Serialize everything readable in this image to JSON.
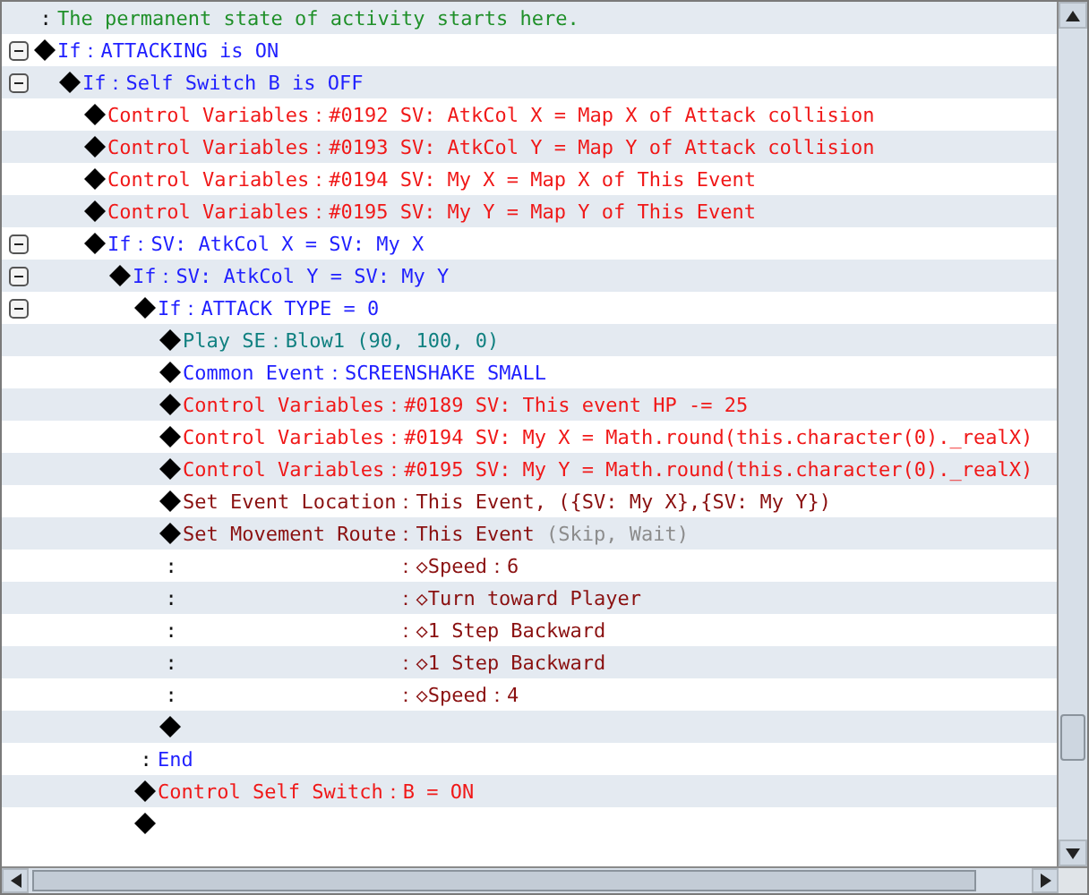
{
  "rows": [
    {
      "kind": "comment",
      "marker": ":",
      "text": "The permanent state of activity starts here."
    },
    {
      "kind": "branch",
      "expanded": true,
      "text": "If：ATTACKING is ON",
      "children": [
        {
          "kind": "branch",
          "expanded": true,
          "text": "If：Self Switch B is OFF",
          "children": [
            {
              "kind": "control",
              "text": "Control Variables：#0192 SV: AtkCol X = Map X of Attack collision"
            },
            {
              "kind": "control",
              "text": "Control Variables：#0193 SV: AtkCol Y = Map Y of Attack collision"
            },
            {
              "kind": "control",
              "text": "Control Variables：#0194 SV: My X = Map X of This Event"
            },
            {
              "kind": "control",
              "text": "Control Variables：#0195 SV: My Y = Map Y of This Event"
            },
            {
              "kind": "branch",
              "expanded": true,
              "text": "If：SV: AtkCol X = SV: My X",
              "children": [
                {
                  "kind": "branch",
                  "expanded": true,
                  "text": "If：SV: AtkCol Y = SV: My Y",
                  "children": [
                    {
                      "kind": "branch",
                      "expanded": true,
                      "text": "If：ATTACK TYPE = 0",
                      "children": [
                        {
                          "kind": "sound",
                          "text": "Play SE：Blow1 (90, 100, 0)"
                        },
                        {
                          "kind": "common",
                          "text": "Common Event：SCREENSHAKE SMALL"
                        },
                        {
                          "kind": "control",
                          "text": "Control Variables：#0189 SV: This event HP -= 25"
                        },
                        {
                          "kind": "control",
                          "text": "Control Variables：#0194 SV: My X = Math.round(this.character(0)._realX)"
                        },
                        {
                          "kind": "control",
                          "text": "Control Variables：#0195 SV: My Y = Math.round(this.character(0)._realX)"
                        },
                        {
                          "kind": "location",
                          "text": "Set Event Location：This Event, ({SV: My X},{SV: My Y})"
                        },
                        {
                          "kind": "route",
                          "text": "Set Movement Route：This Event",
                          "note": "(Skip, Wait)",
                          "steps": [
                            {
                              "marker": ":",
                              "text": "：◇Speed：6"
                            },
                            {
                              "marker": ":",
                              "text": "：◇Turn toward Player"
                            },
                            {
                              "marker": ":",
                              "text": "：◇1 Step Backward"
                            },
                            {
                              "marker": ":",
                              "text": "：◇1 Step Backward"
                            },
                            {
                              "marker": ":",
                              "text": "：◇Speed：4"
                            }
                          ]
                        },
                        {
                          "kind": "empty"
                        }
                      ]
                    },
                    {
                      "kind": "end",
                      "marker": ":",
                      "text": "End"
                    },
                    {
                      "kind": "control",
                      "text": "Control Self Switch：B = ON"
                    },
                    {
                      "kind": "empty"
                    }
                  ]
                }
              ]
            }
          ]
        }
      ]
    }
  ]
}
